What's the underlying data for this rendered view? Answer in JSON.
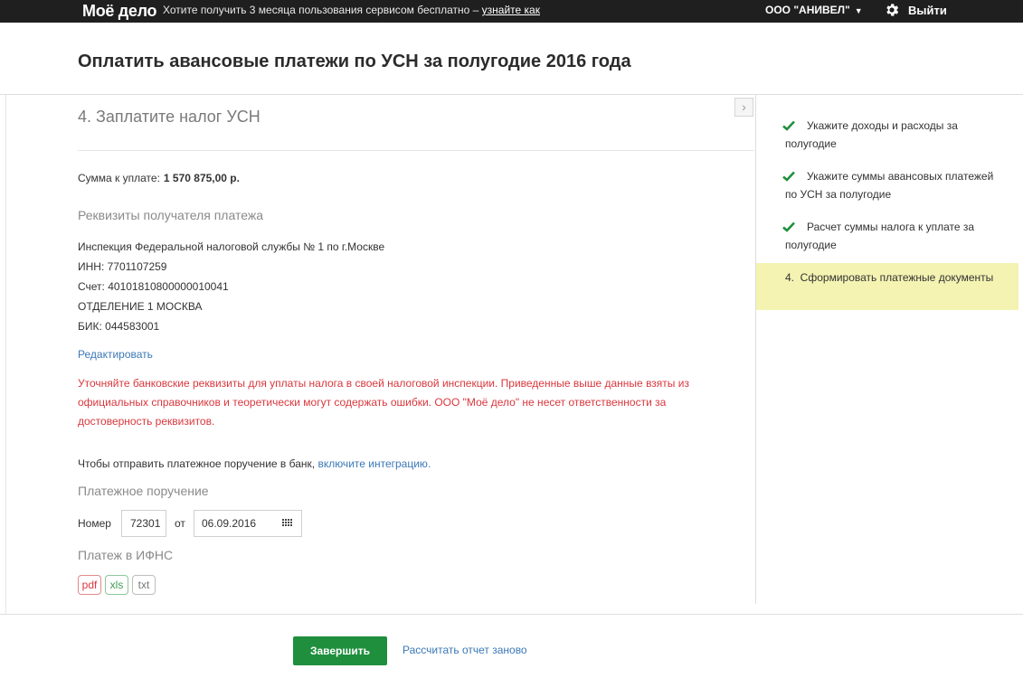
{
  "topbar": {
    "logo": "Моё дело",
    "promo_text": "Хотите получить 3 месяца пользования сервисом бесплатно – ",
    "promo_link": "узнайте как",
    "org_name": "ООО \"АНИВЕЛ\"",
    "logout": "Выйти",
    "icons": {
      "org_caret": "caret-down-icon",
      "settings": "gear-icon"
    }
  },
  "header": {
    "title": "Оплатить авансовые платежи по УСН за полугодие 2016 года"
  },
  "main": {
    "step_title": "4. Заплатите налог УСН",
    "collapse_icon": "chevron-right-icon",
    "sum_label": "Сумма к уплате:",
    "sum_value": "1 570 875,00 р.",
    "recipient_heading": "Реквизиты получателя платежа",
    "recipient": [
      "Инспекция Федеральной налоговой службы № 1 по г.Москве",
      "ИНН: 7701107259",
      "Счет: 40101810800000010041",
      "ОТДЕЛЕНИЕ 1 МОСКВА",
      "БИК: 044583001"
    ],
    "edit_link": "Редактировать",
    "warning": "Уточняйте банковские реквизиты для уплаты налога в своей налоговой инспекции. Приведенные выше данные взяты из официальных справочников и теоретически могут содержать ошибки. ООО \"Моё дело\" не несет ответственности за достоверность реквизитов.",
    "integration_text": "Чтобы отправить платежное поручение в банк, ",
    "integration_link": "включите интеграцию",
    "integration_end": ".",
    "payment_order_heading": "Платежное поручение",
    "number_label": "Номер",
    "number_value": "72301",
    "from_label": "от",
    "date_value": "06.09.2016",
    "date_icon": "calendar-icon",
    "ifns_heading": "Платеж в ИФНС",
    "files": [
      "pdf",
      "xls",
      "txt"
    ]
  },
  "sidebar": {
    "items": [
      {
        "label": "Укажите доходы и расходы за полугодие",
        "done": true
      },
      {
        "label": "Укажите суммы авансовых платежей по УСН за полугодие",
        "done": true
      },
      {
        "label": "Расчет суммы налога к уплате за полугодие",
        "done": true
      },
      {
        "label": "4.  Сформировать платежные документы",
        "done": false,
        "active": true
      }
    ]
  },
  "footer": {
    "finish_button": "Завершить",
    "recalc_link": "Рассчитать отчет заново"
  },
  "colors": {
    "topbar": "#1f1f1f",
    "link": "#3b78b6",
    "warning": "#d9373d",
    "primary_button": "#1f8f3e",
    "active_step": "#f4f3b2",
    "check": "#1f8f3e"
  }
}
